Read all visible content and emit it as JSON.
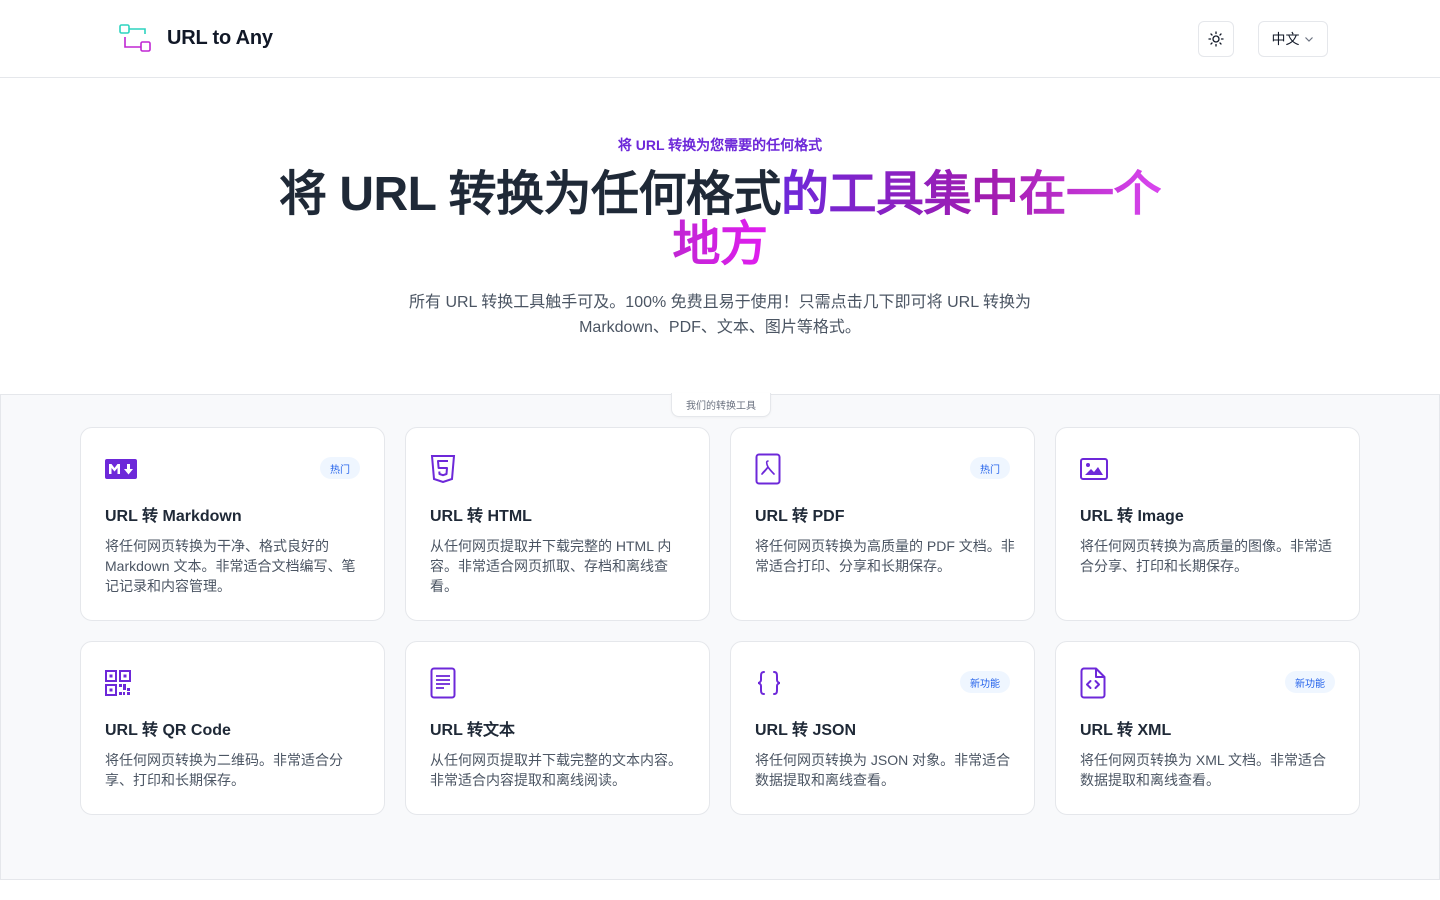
{
  "header": {
    "app_name": "URL to Any",
    "theme_toggle": "sun-icon",
    "language": "中文"
  },
  "hero": {
    "eyebrow": "将 URL 转换为您需要的任何格式",
    "title_plain": "将 URL 转换为任何格式",
    "title_gradient_1": "的工具集中在一个",
    "title_gradient_2": "地方",
    "subtitle": "所有 URL 转换工具触手可及。100% 免费且易于使用！只需点击几下即可将 URL 转换为 Markdown、PDF、文本、图片等格式。"
  },
  "tools": {
    "section_label": "我们的转换工具",
    "accent_color": "#6d28d9",
    "items": [
      {
        "title": "URL 转 Markdown",
        "badge": "热门",
        "icon": "markdown-icon",
        "desc": "将任何网页转换为干净、格式良好的 Markdown 文本。非常适合文档编写、笔记记录和内容管理。"
      },
      {
        "title": "URL 转 HTML",
        "badge": "",
        "icon": "html5-icon",
        "desc": "从任何网页提取并下载完整的 HTML 内容。非常适合网页抓取、存档和离线查看。"
      },
      {
        "title": "URL 转 PDF",
        "badge": "热门",
        "icon": "pdf-icon",
        "desc": "将任何网页转换为高质量的 PDF 文档。非常适合打印、分享和长期保存。"
      },
      {
        "title": "URL 转 Image",
        "badge": "",
        "icon": "image-icon",
        "desc": "将任何网页转换为高质量的图像。非常适合分享、打印和长期保存。"
      },
      {
        "title": "URL 转 QR Code",
        "badge": "",
        "icon": "qr-code-icon",
        "desc": "将任何网页转换为二维码。非常适合分享、打印和长期保存。"
      },
      {
        "title": "URL 转文本",
        "badge": "",
        "icon": "text-document-icon",
        "desc": "从任何网页提取并下载完整的文本内容。非常适合内容提取和离线阅读。"
      },
      {
        "title": "URL 转 JSON",
        "badge": "新功能",
        "icon": "json-braces-icon",
        "desc": "将任何网页转换为 JSON 对象。非常适合数据提取和离线查看。"
      },
      {
        "title": "URL 转 XML",
        "badge": "新功能",
        "icon": "xml-file-icon",
        "desc": "将任何网页转换为 XML 文档。非常适合数据提取和离线查看。"
      }
    ]
  }
}
